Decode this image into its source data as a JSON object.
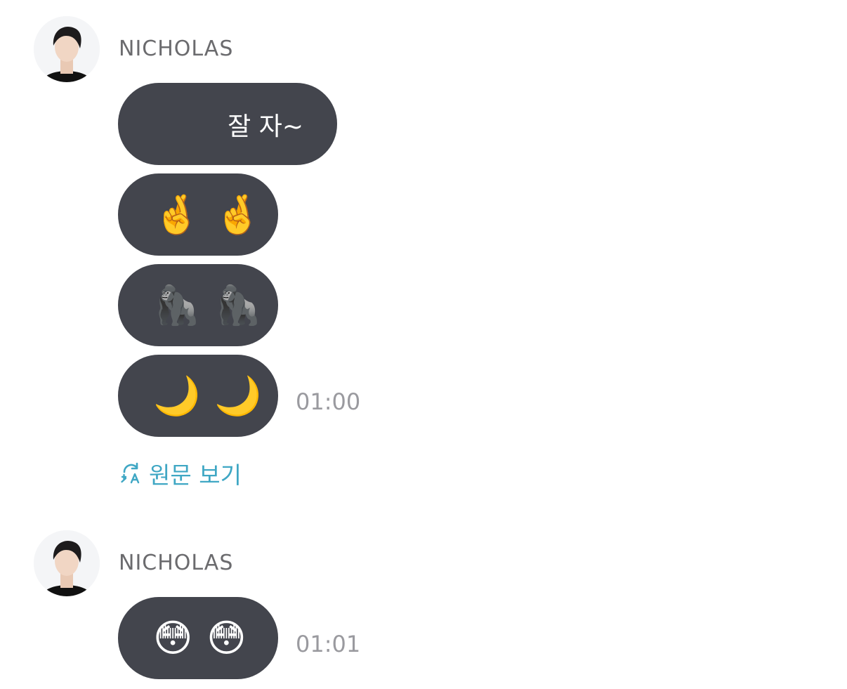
{
  "messages": [
    {
      "sender": "NICHOLAS",
      "bubbles": [
        {
          "text": "잘 자~"
        },
        {
          "emoji": [
            "🤞",
            "🤞"
          ]
        },
        {
          "emoji": [
            "🦍",
            "🦍"
          ]
        },
        {
          "emoji": [
            "🌙",
            "🌙"
          ]
        }
      ],
      "time": "01:00",
      "translate_label": "원문 보기"
    },
    {
      "sender": "NICHOLAS",
      "bubbles": [
        {
          "emoji": [
            "😳",
            "😳"
          ]
        }
      ],
      "time": "01:01"
    }
  ],
  "colors": {
    "bubble_bg": "#43454d",
    "bubble_text": "#ffffff",
    "sender_text": "#6b6b6e",
    "time_text": "#9a9a9f",
    "link_accent": "#3fa7c4"
  },
  "icons": {
    "avatar": "profile-photo-avatar",
    "translate": "translate-refresh-icon"
  }
}
